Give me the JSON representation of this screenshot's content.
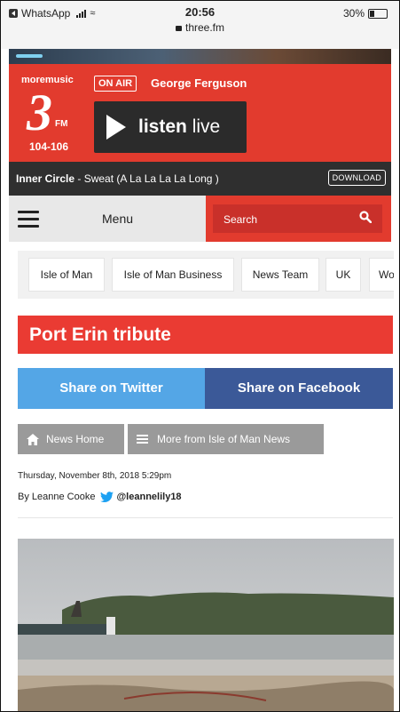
{
  "statusbar": {
    "carrier": "WhatsApp",
    "time": "20:56",
    "url": "three.fm",
    "battery": "30%"
  },
  "station": {
    "brand": "moremusic",
    "logo_number": "3",
    "logo_fm": "FM",
    "frequency": "104-106",
    "onair_label": "ON AIR",
    "presenter": "George Ferguson",
    "listen_bold": "listen",
    "listen_rest": " live"
  },
  "nowplaying": {
    "artist": "Inner Circle",
    "track": " - Sweat (A La La La La Long )",
    "download_label": "DOWNLOAD"
  },
  "menu": {
    "label": "Menu",
    "search_placeholder": "Search"
  },
  "tags": [
    "Isle of Man",
    "Isle of Man Business",
    "News Team",
    "UK",
    "Wo"
  ],
  "article": {
    "headline": "Port Erin tribute",
    "share_twitter": "Share on Twitter",
    "share_facebook": "Share on Facebook",
    "nav_home": "News Home",
    "nav_more": "More from Isle of Man News",
    "date": "Thursday, November 8th, 2018 5:29pm",
    "author": "By Leanne Cooke",
    "twitter_handle": "@leannelily18"
  },
  "colors": {
    "brand_red": "#e23b2e",
    "twitter": "#54a6e6",
    "facebook": "#3b5998",
    "nav_grey": "#9a9a9a"
  },
  "icons": [
    "back-icon",
    "signal-icon",
    "wifi-icon",
    "lock-icon",
    "battery-icon",
    "play-icon",
    "hamburger-icon",
    "search-icon",
    "home-icon",
    "list-icon",
    "twitter-bird-icon"
  ]
}
